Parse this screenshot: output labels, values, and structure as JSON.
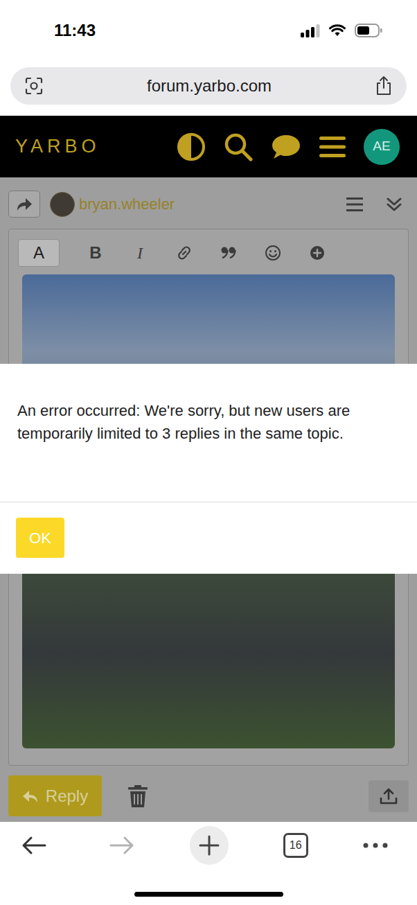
{
  "status_bar": {
    "time": "11:43"
  },
  "address_bar": {
    "url": "forum.yarbo.com"
  },
  "site_header": {
    "logo": "YARBO",
    "avatar": "AE"
  },
  "composer": {
    "user": "bryan.wheeler",
    "toolbar": [
      {
        "label": "A",
        "selected": true
      },
      {
        "label": "B",
        "selected": false
      },
      {
        "label": "I",
        "selected": false
      }
    ],
    "reply_button": "Reply"
  },
  "dialog": {
    "message": "An error occurred: We're sorry, but new users are temporarily limited to 3 replies in the same topic.",
    "button": "OK"
  },
  "browser_toolbar": {
    "tab_count": "16",
    "forward_disabled": true
  }
}
